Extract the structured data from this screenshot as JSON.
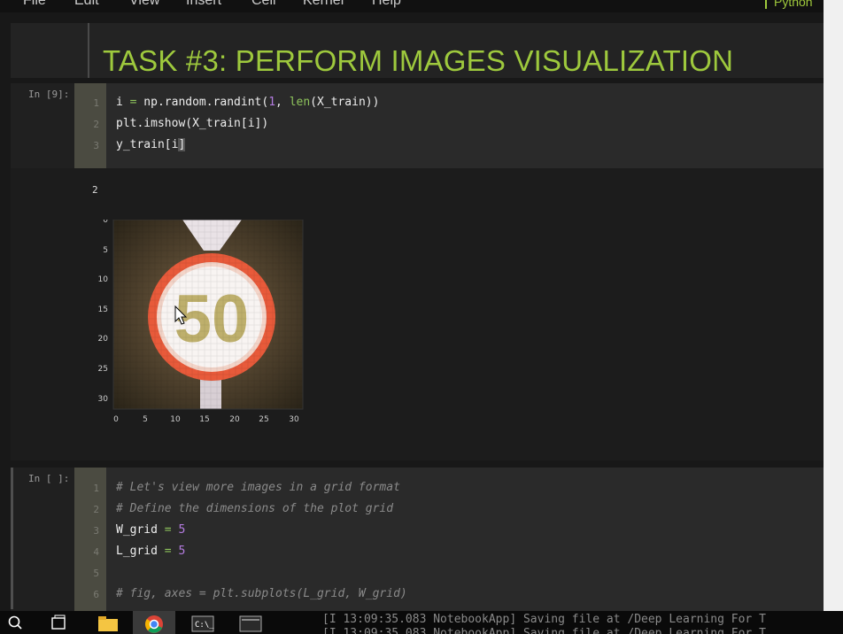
{
  "menu": {
    "items": [
      "File",
      "Edit",
      "View",
      "Insert",
      "Cell",
      "Kernel",
      "Help"
    ],
    "kernel": "Python"
  },
  "markdown": {
    "heading": "TASK #3: PERFORM IMAGES VISUALIZATION"
  },
  "cell1": {
    "prompt": "In [9]:",
    "lines": [
      {
        "num": "1",
        "code": "i = np.random.randint(1, len(X_train))"
      },
      {
        "num": "2",
        "code": "plt.imshow(X_train[i])"
      },
      {
        "num": "3",
        "code": "y_train[i]"
      }
    ],
    "output_text": "2",
    "plot": {
      "y_ticks": [
        "0",
        "5",
        "10",
        "15",
        "20",
        "25",
        "30"
      ],
      "x_ticks": [
        "0",
        "5",
        "10",
        "15",
        "20",
        "25",
        "30"
      ],
      "sign_text": "50"
    }
  },
  "cell2": {
    "prompt": "In [ ]:",
    "lines": [
      {
        "num": "1",
        "code": "# Let's view more images in a grid format"
      },
      {
        "num": "2",
        "code": "# Define the dimensions of the plot grid"
      },
      {
        "num": "3",
        "code": "W_grid = 5"
      },
      {
        "num": "4",
        "code": "L_grid = 5"
      },
      {
        "num": "5",
        "code": ""
      },
      {
        "num": "6",
        "code": "# fig, axes = plt.subplots(L_grid, W_grid)"
      }
    ]
  },
  "taskbar": {
    "log_lines": [
      "[I 13:09:35.083 NotebookApp] Saving file at /Deep Learning For T",
      "[I 13:09:35.083 NotebookApp] Saving file at /Deep Learning For T"
    ],
    "icons": [
      "search-icon",
      "task-view-icon",
      "file-explorer-icon",
      "chrome-icon",
      "terminal-icon",
      "terminal-icon"
    ]
  },
  "colors": {
    "heading": "#9ec93d",
    "keyword": "#8ec45c",
    "number": "#b47ce0",
    "comment": "#8a8a8a"
  }
}
